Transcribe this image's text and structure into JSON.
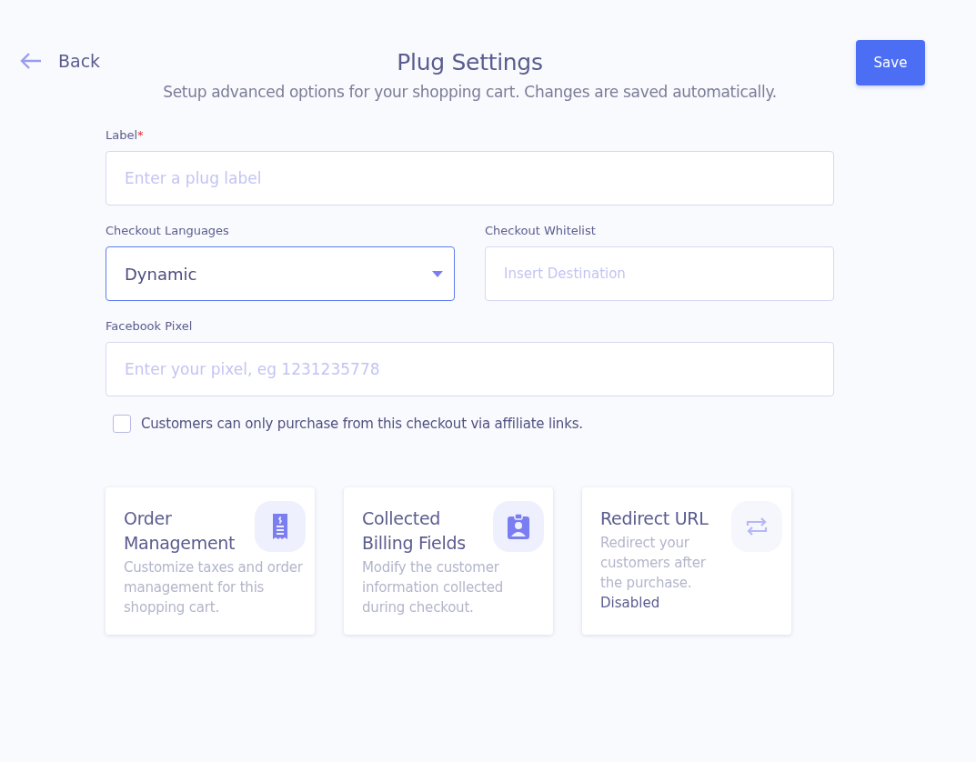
{
  "header": {
    "back": "Back",
    "title": "Plug Settings",
    "subtitle": "Setup advanced options for your shopping cart. Changes are saved automatically.",
    "save": "Save"
  },
  "label_field": {
    "label": "Label",
    "required_mark": "*",
    "placeholder": "Enter a plug label"
  },
  "checkout_languages": {
    "label": "Checkout Languages",
    "value": "Dynamic",
    "focused": true
  },
  "checkout_whitelist": {
    "label": "Checkout Whitelist",
    "placeholder": "Insert Destination"
  },
  "facebook_pixel": {
    "label": "Facebook Pixel",
    "placeholder": "Enter your pixel, eg 1231235778"
  },
  "affiliate_checkbox": {
    "label": "Customers can only purchase from this checkout via affiliate links.",
    "checked": false
  },
  "cards": [
    {
      "kind": "receipt",
      "title": "Order Management",
      "description": "Customize taxes and order management for this shopping cart.",
      "disabled": false
    },
    {
      "kind": "badge",
      "title": "Collected Billing Fields",
      "description": "Modify the customer information collected during checkout.",
      "disabled": false
    },
    {
      "kind": "swap",
      "title": "Redirect URL",
      "description": "Redirect your customers after the purchase.",
      "status": "Disabled",
      "disabled": true
    }
  ]
}
